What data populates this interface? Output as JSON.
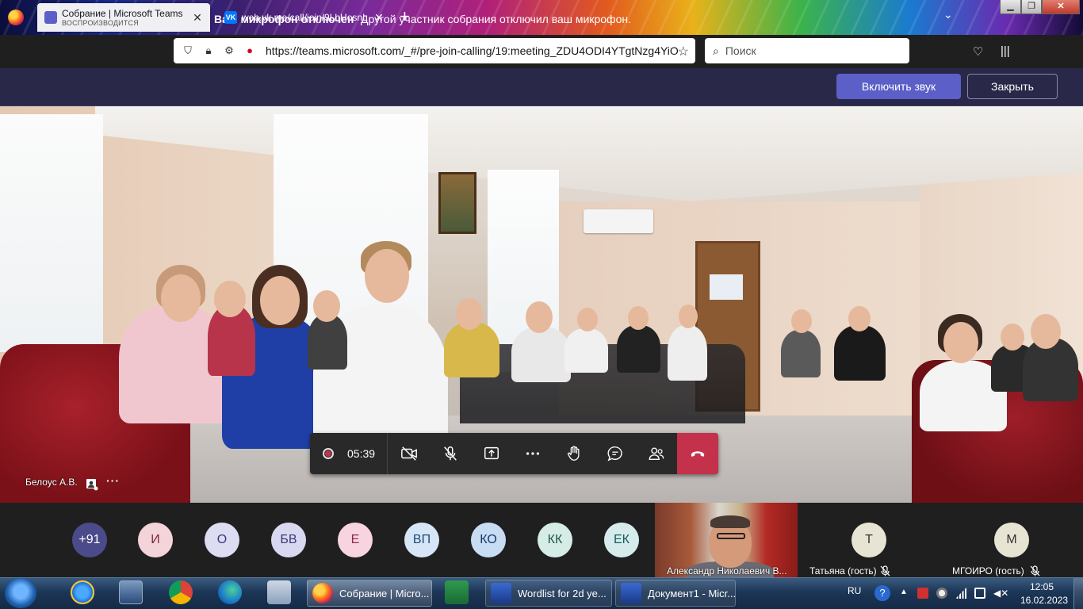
{
  "browser": {
    "tabs": [
      {
        "title": "Собрание | Microsoft Teams",
        "subtitle": "ВОСПРОИЗВОДИТСЯ",
        "active": true
      },
      {
        "title": "web.vk.me/call/join/9LhHosnL",
        "subtitle": "",
        "active": false
      }
    ],
    "url": "https://teams.microsoft.com/_#/pre-join-calling/19:meeting_ZDU4ODI4YTgtNzg4YiOC",
    "search_placeholder": "Поиск"
  },
  "notification": {
    "bold": "Ваш микрофон отключен",
    "text": "Другой участник собрания отключил ваш микрофон.",
    "unmute_label": "Включить звук",
    "close_label": "Закрыть"
  },
  "meeting": {
    "timer": "05:39",
    "speaker_name": "Белоус А.В.",
    "more": "···"
  },
  "participants": {
    "avatars": [
      {
        "initials": "+91",
        "bg": "#4b4a8a",
        "fg": "#ffffff"
      },
      {
        "initials": "И",
        "bg": "#f4d3d9",
        "fg": "#7a2a3a"
      },
      {
        "initials": "О",
        "bg": "#dcdcf2",
        "fg": "#3a3a7a"
      },
      {
        "initials": "БВ",
        "bg": "#d8d8f0",
        "fg": "#3a3a7a"
      },
      {
        "initials": "Е",
        "bg": "#f8d4e0",
        "fg": "#8a2a4a"
      },
      {
        "initials": "ВП",
        "bg": "#d6e6f6",
        "fg": "#1f4a7a"
      },
      {
        "initials": "КО",
        "bg": "#c8dcf4",
        "fg": "#1a3a6a"
      },
      {
        "initials": "КК",
        "bg": "#d6ece6",
        "fg": "#1f5a4a"
      },
      {
        "initials": "ЕК",
        "bg": "#d6ecec",
        "fg": "#1a5a5a"
      }
    ],
    "video_name": "Александр Николаевич В...",
    "guests": [
      {
        "initials": "Т",
        "name": "Татьяна (гость)"
      },
      {
        "initials": "М",
        "name": "МГОИРО (гость)"
      }
    ]
  },
  "taskbar": {
    "tasks": [
      {
        "label": "Собрание | Micro..."
      },
      {
        "label": "Wordlist for 2d ye..."
      },
      {
        "label": "Документ1 - Micr..."
      }
    ],
    "lang": "RU",
    "time": "12:05",
    "date": "16.02.2023"
  }
}
